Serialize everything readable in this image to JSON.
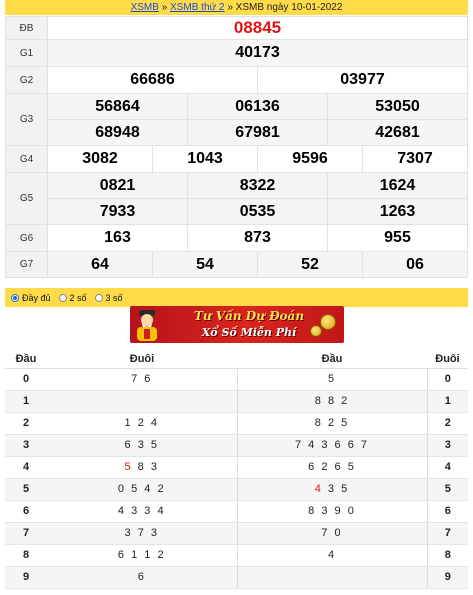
{
  "breadcrumb": {
    "link1": "XSMB",
    "sep1": " » ",
    "link2": "XSMB thứ 2",
    "sep2": " » ",
    "current": "XSMB ngày 10-01-2022"
  },
  "results": {
    "db": {
      "label": "ĐB",
      "values": [
        "08845"
      ]
    },
    "g1": {
      "label": "G1",
      "values": [
        "40173"
      ]
    },
    "g2": {
      "label": "G2",
      "values": [
        "66686",
        "03977"
      ]
    },
    "g3": {
      "label": "G3",
      "values": [
        "56864",
        "06136",
        "53050",
        "68948",
        "67981",
        "42681"
      ]
    },
    "g4": {
      "label": "G4",
      "values": [
        "3082",
        "1043",
        "9596",
        "7307"
      ]
    },
    "g5": {
      "label": "G5",
      "values": [
        "0821",
        "8322",
        "1624",
        "7933",
        "0535",
        "1263"
      ]
    },
    "g6": {
      "label": "G6",
      "values": [
        "163",
        "873",
        "955"
      ]
    },
    "g7": {
      "label": "G7",
      "values": [
        "64",
        "54",
        "52",
        "06"
      ]
    }
  },
  "options": [
    {
      "label": "Đầy đủ",
      "checked": true
    },
    {
      "label": "2 số",
      "checked": false
    },
    {
      "label": "3 số",
      "checked": false
    }
  ],
  "banner": {
    "line1": "Tư Vấn Dự Đoán",
    "line2": "Xổ Số Miễn Phí"
  },
  "loto": {
    "headers": {
      "dau": "Đầu",
      "duoi": "Đuôi",
      "dau2": "Đầu",
      "duoi2": "Đuôi"
    },
    "rows": [
      {
        "dau": "0",
        "duoi_pre": "",
        "duoi_hl": "",
        "duoi_post": "7 6",
        "dau2_pre": "",
        "dau2_hl": "",
        "dau2_post": "5",
        "duoi2": "0"
      },
      {
        "dau": "1",
        "duoi_pre": "",
        "duoi_hl": "",
        "duoi_post": "",
        "dau2_pre": "",
        "dau2_hl": "",
        "dau2_post": "8 8 2",
        "duoi2": "1"
      },
      {
        "dau": "2",
        "duoi_pre": "",
        "duoi_hl": "",
        "duoi_post": "1 2 4",
        "dau2_pre": "",
        "dau2_hl": "",
        "dau2_post": "8 2 5",
        "duoi2": "2"
      },
      {
        "dau": "3",
        "duoi_pre": "",
        "duoi_hl": "",
        "duoi_post": "6 3 5",
        "dau2_pre": "",
        "dau2_hl": "",
        "dau2_post": "7 4 3 6 6 7",
        "duoi2": "3"
      },
      {
        "dau": "4",
        "duoi_pre": "",
        "duoi_hl": "5",
        "duoi_post": " 8 3",
        "dau2_pre": "",
        "dau2_hl": "",
        "dau2_post": "6 2 6 5",
        "duoi2": "4"
      },
      {
        "dau": "5",
        "duoi_pre": "",
        "duoi_hl": "",
        "duoi_post": "0 5 4 2",
        "dau2_pre": "",
        "dau2_hl": "4",
        "dau2_post": " 3 5",
        "duoi2": "5"
      },
      {
        "dau": "6",
        "duoi_pre": "",
        "duoi_hl": "",
        "duoi_post": "4 3 3 4",
        "dau2_pre": "",
        "dau2_hl": "",
        "dau2_post": "8 3 9 0",
        "duoi2": "6"
      },
      {
        "dau": "7",
        "duoi_pre": "",
        "duoi_hl": "",
        "duoi_post": "3 7 3",
        "dau2_pre": "",
        "dau2_hl": "",
        "dau2_post": "7 0",
        "duoi2": "7"
      },
      {
        "dau": "8",
        "duoi_pre": "",
        "duoi_hl": "",
        "duoi_post": "6 1 1 2",
        "dau2_pre": "",
        "dau2_hl": "",
        "dau2_post": "4",
        "duoi2": "8"
      },
      {
        "dau": "9",
        "duoi_pre": "",
        "duoi_hl": "",
        "duoi_post": "6",
        "dau2_pre": "",
        "dau2_hl": "",
        "dau2_post": "",
        "duoi2": "9"
      }
    ]
  },
  "colors": {
    "accent_yellow": "#ffdb4a",
    "special_red": "#e01414",
    "link_blue": "#1a4fd6"
  }
}
